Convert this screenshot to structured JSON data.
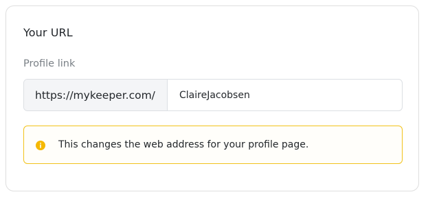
{
  "card": {
    "title": "Your URL",
    "field_label": "Profile link",
    "url_prefix": "https://mykeeper.com/",
    "username_value": "ClaireJacobsen",
    "notice": {
      "icon": "info-icon",
      "text": "This changes the web address for your profile page."
    }
  },
  "colors": {
    "notice_border": "#f2c21a",
    "notice_icon": "#f5b800",
    "prefix_background": "#f4f5f7"
  }
}
